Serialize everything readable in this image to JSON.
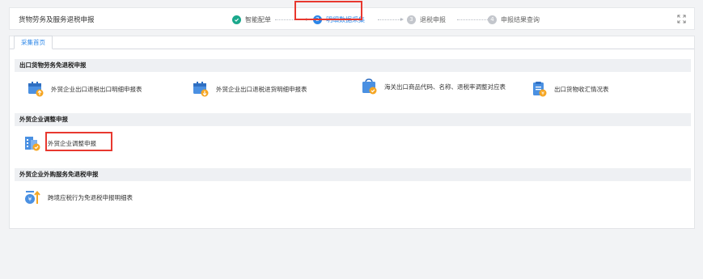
{
  "header": {
    "app_title": "货物劳务及服务退税申报",
    "steps": [
      {
        "num": "",
        "label": "智能配单",
        "state": "done"
      },
      {
        "num": "2",
        "label": "明细数据采集",
        "state": "active"
      },
      {
        "num": "3",
        "label": "退税申报",
        "state": "todo"
      },
      {
        "num": "4",
        "label": "申报结果查询",
        "state": "todo"
      }
    ],
    "expand_icon": "expand-icon"
  },
  "tabs": [
    {
      "label": "采集首页"
    }
  ],
  "sections": [
    {
      "title": "出口货物劳务免退税申报",
      "items": [
        {
          "label": "外贸企业出口退税出口明细申报表",
          "icon": "export-detail-icon"
        },
        {
          "label": "外贸企业出口退税进货明细申报表",
          "icon": "purchase-detail-icon"
        },
        {
          "label": "海关出口商品代码、名称、退税率调整对应表",
          "icon": "customs-code-icon"
        },
        {
          "label": "出口货物收汇情况表",
          "icon": "forex-receipt-icon"
        }
      ]
    },
    {
      "title": "外贸企业调整申报",
      "items": [
        {
          "label": "外贸企业调整申报",
          "icon": "adjustment-icon"
        }
      ]
    },
    {
      "title": "外贸企业外购服务免退税申报",
      "items": [
        {
          "label": "跨境应税行为免退税申报明细表",
          "icon": "cross-border-icon"
        }
      ]
    }
  ],
  "colors": {
    "accent": "#2b86e8",
    "highlight": "#e8382f",
    "done": "#1aa88c",
    "orange": "#f5a623"
  }
}
